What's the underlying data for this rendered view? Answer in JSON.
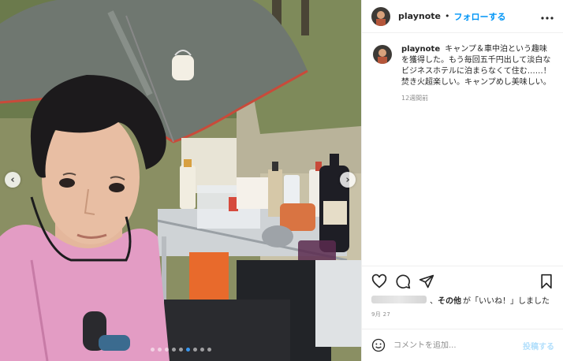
{
  "post": {
    "username": "playnote",
    "separator": "•",
    "follow_label": "フォローする",
    "more_icon": "more-horizontal-icon",
    "caption": {
      "username": "playnote",
      "text": "キャンプ＆車中泊という趣味を獲得した。もう毎回五千円出して淡白なビジネスホテルに泊まらなくて住む……！　焚き火超楽しい。キャンプめし美味しい。",
      "time_ago": "12週間前"
    },
    "actions": {
      "like_icon": "heart-icon",
      "comment_icon": "comment-icon",
      "share_icon": "send-icon",
      "save_icon": "bookmark-icon"
    },
    "likes": {
      "others_bold": "その他",
      "suffix": "が「いいね！」しました"
    },
    "date": "9月 27",
    "comment_box": {
      "placeholder": "コメントを追加...",
      "post_label": "投稿する"
    }
  },
  "carousel": {
    "prev_glyph": "‹",
    "next_glyph": "›",
    "dot_count": 9,
    "active_dot": 5
  },
  "colors": {
    "accent": "#0095f6",
    "post_button_disabled": "#b2dffc",
    "carousel_active_dot": "#3897f0"
  }
}
